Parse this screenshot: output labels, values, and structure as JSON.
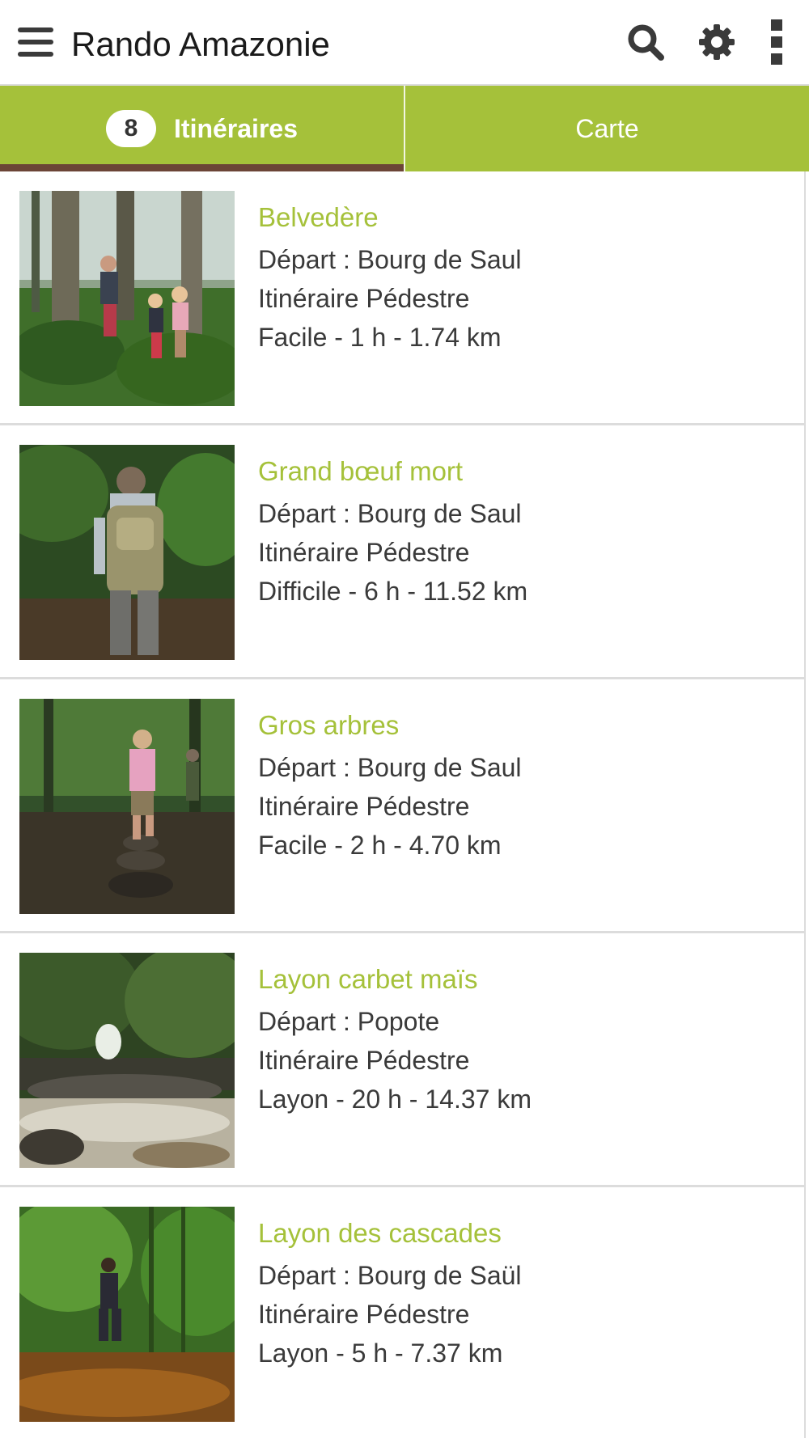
{
  "app": {
    "title": "Rando Amazonie"
  },
  "toolbar": {
    "icons": [
      "menu-icon",
      "search-icon",
      "gear-icon",
      "more-vertical-icon"
    ]
  },
  "tabs": [
    {
      "label": "Itinéraires",
      "badge": "8",
      "active": true
    },
    {
      "label": "Carte",
      "active": false
    }
  ],
  "colors": {
    "accent": "#a5c13a",
    "tab_indicator": "#6b4436",
    "text": "#3a3a3a",
    "divider": "#dcdcdc"
  },
  "routes": [
    {
      "name": "Belvedère",
      "departure": "Départ : Bourg de Saul",
      "type": "Itinéraire Pédestre",
      "details": "Facile - 1 h - 1.74 km"
    },
    {
      "name": "Grand bœuf mort",
      "departure": "Départ : Bourg de Saul",
      "type": "Itinéraire Pédestre",
      "details": "Difficile - 6 h - 11.52 km"
    },
    {
      "name": "Gros arbres",
      "departure": "Départ : Bourg de Saul",
      "type": "Itinéraire Pédestre",
      "details": "Facile - 2 h - 4.70 km"
    },
    {
      "name": "Layon carbet maïs",
      "departure": "Départ : Popote",
      "type": "Itinéraire Pédestre",
      "details": "Layon - 20 h - 14.37 km"
    },
    {
      "name": "Layon des cascades",
      "departure": "Départ : Bourg de Saül",
      "type": "Itinéraire Pédestre",
      "details": "Layon - 5 h - 7.37 km"
    }
  ]
}
